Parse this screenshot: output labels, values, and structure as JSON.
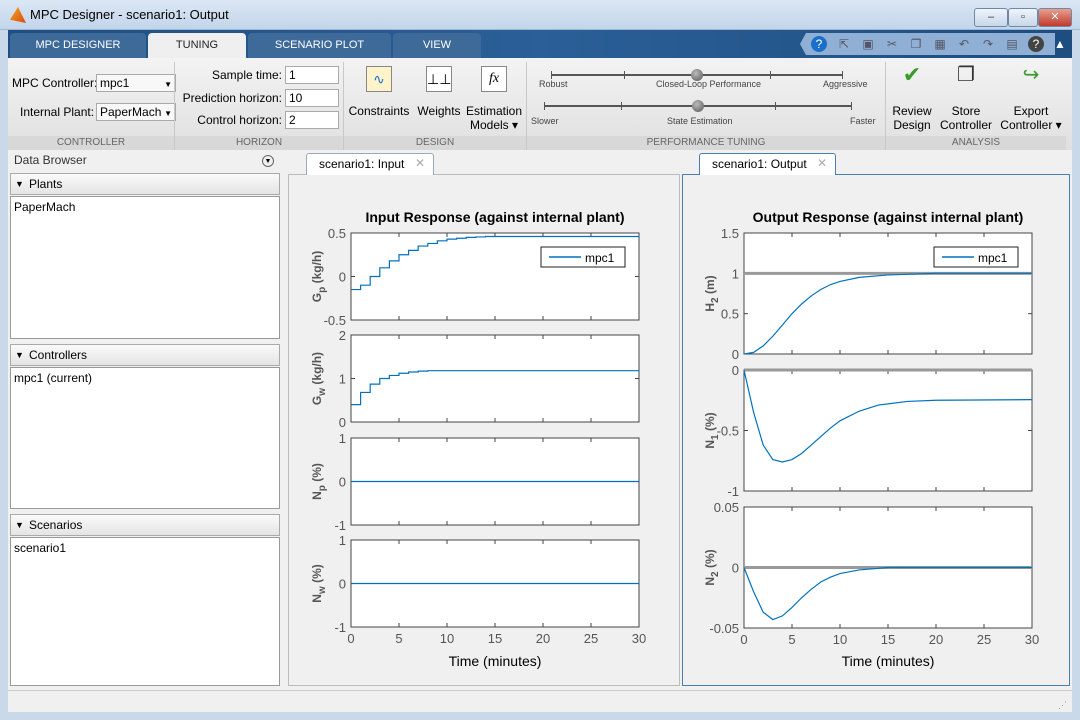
{
  "window": {
    "title": "MPC Designer - scenario1: Output",
    "minimize": "–",
    "maximize": "▫",
    "close": "✕"
  },
  "tabs": [
    {
      "label": "MPC DESIGNER"
    },
    {
      "label": "TUNING"
    },
    {
      "label": "SCENARIO PLOT"
    },
    {
      "label": "VIEW"
    }
  ],
  "quick_access": [
    "help-icon",
    "new-icon",
    "save-icon",
    "cut-icon",
    "copy-icon",
    "paste-icon",
    "undo-icon",
    "redo-icon",
    "layout-icon",
    "help2-icon",
    "collapse-ribbon-icon"
  ],
  "controller": {
    "mpc_label": "MPC Controller:",
    "mpc_value": "mpc1",
    "plant_label": "Internal Plant:",
    "plant_value": "PaperMach",
    "section": "CONTROLLER"
  },
  "horizon": {
    "sample_label": "Sample time:",
    "sample_value": "1",
    "pred_label": "Prediction horizon:",
    "pred_value": "10",
    "ctrl_label": "Control horizon:",
    "ctrl_value": "2",
    "section": "HORIZON"
  },
  "design": {
    "constraints": "Constraints",
    "weights": "Weights",
    "estimation1": "Estimation",
    "estimation2": "Models ▾",
    "section": "DESIGN"
  },
  "tuning": {
    "perf_left": "Robust",
    "perf_mid": "Closed-Loop Performance",
    "perf_right": "Aggressive",
    "perf_value": 0.5,
    "est_left": "Slower",
    "est_mid": "State Estimation",
    "est_right": "Faster",
    "est_value": 0.5,
    "section": "PERFORMANCE TUNING"
  },
  "analysis": {
    "review1": "Review",
    "review2": "Design",
    "store1": "Store",
    "store2": "Controller",
    "export1": "Export",
    "export2": "Controller ▾",
    "section": "ANALYSIS"
  },
  "browser": {
    "title": "Data Browser",
    "plants": "Plants",
    "plant_items": [
      "PaperMach"
    ],
    "controllers": "Controllers",
    "controller_items": [
      "mpc1 (current)"
    ],
    "scenarios": "Scenarios",
    "scenario_items": [
      "scenario1"
    ]
  },
  "doc_tabs": {
    "input": "scenario1: Input",
    "output": "scenario1: Output"
  },
  "colors": {
    "series": "#0072bd",
    "reference": "#999999"
  },
  "chart_data": [
    {
      "type": "line",
      "title": "Input Response (against internal plant)",
      "xlabel": "Time (minutes)",
      "xlim": [
        0,
        30
      ],
      "xticks": [
        0,
        5,
        10,
        15,
        20,
        25,
        30
      ],
      "legend": {
        "entries": [
          "mpc1"
        ],
        "placement": "top-right"
      },
      "panels": [
        {
          "ylabel": "G",
          "ysub": "p",
          "yunit": "(kg/h)",
          "ylim": [
            -0.5,
            0.5
          ],
          "yticks": [
            "-0.5",
            "0",
            "0.5"
          ],
          "step": true,
          "x": [
            0,
            1,
            2,
            3,
            4,
            5,
            6,
            7,
            8,
            9,
            10,
            11,
            12,
            13,
            14,
            30
          ],
          "y": [
            -0.15,
            -0.1,
            0,
            0.1,
            0.18,
            0.25,
            0.3,
            0.35,
            0.38,
            0.41,
            0.43,
            0.44,
            0.45,
            0.455,
            0.46,
            0.46
          ]
        },
        {
          "ylabel": "G",
          "ysub": "w",
          "yunit": "(kg/h)",
          "ylim": [
            0,
            2
          ],
          "yticks": [
            "0",
            "1",
            "2"
          ],
          "step": true,
          "x": [
            0,
            1,
            2,
            3,
            4,
            5,
            6,
            7,
            8,
            9,
            10,
            30
          ],
          "y": [
            0.4,
            0.68,
            0.87,
            1.0,
            1.07,
            1.12,
            1.15,
            1.17,
            1.18,
            1.18,
            1.18,
            1.17
          ]
        },
        {
          "ylabel": "N",
          "ysub": "p",
          "yunit": "(%)",
          "ylim": [
            -1,
            1
          ],
          "yticks": [
            "-1",
            "0",
            "1"
          ],
          "step": false,
          "x": [
            0,
            30
          ],
          "y": [
            0,
            0
          ]
        },
        {
          "ylabel": "N",
          "ysub": "w",
          "yunit": "(%)",
          "ylim": [
            -1,
            1
          ],
          "yticks": [
            "-1",
            "0",
            "1"
          ],
          "step": false,
          "x": [
            0,
            30
          ],
          "y": [
            0,
            0
          ]
        }
      ]
    },
    {
      "type": "line",
      "title": "Output Response (against internal plant)",
      "xlabel": "Time (minutes)",
      "xlim": [
        0,
        30
      ],
      "xticks": [
        0,
        5,
        10,
        15,
        20,
        25,
        30
      ],
      "legend": {
        "entries": [
          "mpc1"
        ],
        "placement": "top-right"
      },
      "panels": [
        {
          "ylabel": "H",
          "ysub": "2",
          "yunit": "(m)",
          "ylim": [
            0,
            1.5
          ],
          "yticks": [
            "0",
            "0.5",
            "1",
            "1.5"
          ],
          "reference": 1,
          "x": [
            0,
            1,
            2,
            3,
            4,
            5,
            6,
            7,
            8,
            9,
            10,
            12,
            15,
            20,
            30
          ],
          "y": [
            0,
            0.02,
            0.1,
            0.22,
            0.36,
            0.5,
            0.62,
            0.72,
            0.8,
            0.86,
            0.9,
            0.95,
            0.98,
            1.0,
            1.0
          ]
        },
        {
          "ylabel": "N",
          "ysub": "1",
          "yunit": "(%)",
          "ylim": [
            -1,
            0
          ],
          "yticks": [
            "-1",
            "-0.5",
            "0"
          ],
          "reference": 0,
          "x": [
            0,
            1,
            2,
            3,
            4,
            5,
            6,
            7,
            8,
            9,
            10,
            12,
            14,
            17,
            20,
            30
          ],
          "y": [
            0,
            -0.35,
            -0.62,
            -0.74,
            -0.76,
            -0.74,
            -0.69,
            -0.62,
            -0.55,
            -0.48,
            -0.42,
            -0.34,
            -0.29,
            -0.26,
            -0.25,
            -0.245
          ]
        },
        {
          "ylabel": "N",
          "ysub": "2",
          "yunit": "(%)",
          "ylim": [
            -0.05,
            0.05
          ],
          "yticks": [
            "-0.05",
            "0",
            "0.05"
          ],
          "reference": 0,
          "x": [
            0,
            1,
            2,
            3,
            4,
            5,
            6,
            7,
            8,
            9,
            10,
            12,
            15,
            30
          ],
          "y": [
            0,
            -0.02,
            -0.037,
            -0.043,
            -0.04,
            -0.033,
            -0.025,
            -0.018,
            -0.012,
            -0.008,
            -0.005,
            -0.002,
            0,
            0
          ]
        }
      ]
    }
  ]
}
